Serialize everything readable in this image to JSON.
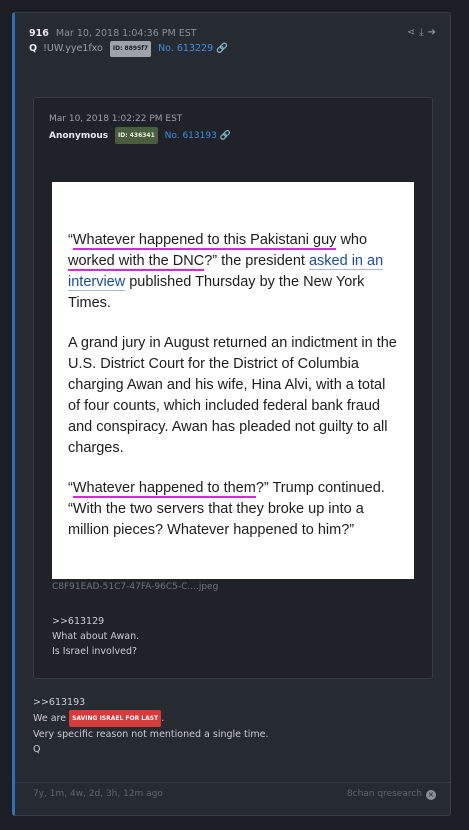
{
  "post": {
    "number": "916",
    "date": "Mar 10, 2018 1:04:36 PM EST",
    "author": "Q",
    "tripcode": "!UW.yye1fxo",
    "id": "ID: 8895f7",
    "post_no": "No. 613229"
  },
  "quoted": {
    "date": "Mar 10, 2018 1:02:22 PM EST",
    "author": "Anonymous",
    "id": "ID: 436341",
    "post_no": "No. 613193",
    "image": {
      "p1_a": "“",
      "p1_hl1": "Whatever happened to this Pakistani guy",
      "p1_b": " who ",
      "p1_hl2": "worked with the DNC",
      "p1_c": "?” the president ",
      "p1_link": "asked in an interview",
      "p1_d": " published Thursday by the New York Times.",
      "p2": "A grand jury in August returned an indictment in the U.S. District Court for the District of Columbia charging Awan and his wife, Hina Alvi, with a total of four counts, which included federal bank fraud and conspiracy. Awan has pleaded not guilty to all charges.",
      "p3_a": "“",
      "p3_hl": "Whatever happened to them",
      "p3_b": "?” Trump continued. “With the two servers that they broke up into a million pieces? Whatever happened to him?”"
    },
    "filename": "C8F91EAD-51C7-47FA-96C5-C....jpeg",
    "lines": [
      ">>613129",
      "What about Awan.",
      "Is Israel involved?"
    ]
  },
  "body": {
    "ref": ">>613193",
    "line2_a": "We are ",
    "badge": "SAVING ISRAEL FOR LAST",
    "line2_b": ".",
    "line3": "Very specific reason not mentioned a single time.",
    "line4": "Q"
  },
  "footer": {
    "age": "7y, 1m, 4w, 2d, 3h, 12m ago",
    "source": "8chan qresearch"
  },
  "colors": {
    "accent": "#2f6fb5",
    "highlight": "#d42ad8",
    "badge_red": "#d63a3a"
  }
}
